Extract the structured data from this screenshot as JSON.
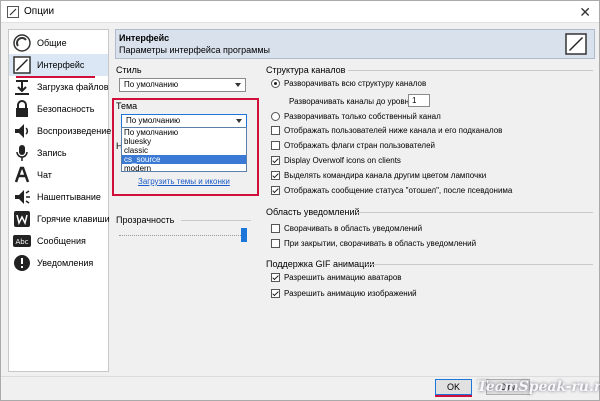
{
  "window": {
    "title": "Опции",
    "close_glyph": "✕"
  },
  "sidebar": {
    "items": [
      {
        "label": "Общие",
        "icon": "general-icon"
      },
      {
        "label": "Интерфейс",
        "icon": "interface-icon",
        "active": true
      },
      {
        "label": "Загрузка файлов",
        "icon": "file-transfer-icon"
      },
      {
        "label": "Безопасность",
        "icon": "security-icon"
      },
      {
        "label": "Воспроизведение",
        "icon": "playback-icon"
      },
      {
        "label": "Запись",
        "icon": "capture-icon"
      },
      {
        "label": "Чат",
        "icon": "chat-icon"
      },
      {
        "label": "Нашептывание",
        "icon": "whisper-icon"
      },
      {
        "label": "Горячие клавиши",
        "icon": "hotkeys-icon"
      },
      {
        "label": "Сообщения",
        "icon": "messages-icon"
      },
      {
        "label": "Уведомления",
        "icon": "notifications-icon"
      }
    ]
  },
  "header": {
    "title": "Интерфейс",
    "subtitle": "Параметры интерфейса программы"
  },
  "left": {
    "style_label": "Стиль",
    "style_value": "По умолчанию",
    "theme_label": "Тема",
    "theme_value": "По умолчанию",
    "theme_options": [
      "По умолчанию",
      "bluesky",
      "classic",
      "cs_source",
      "modern"
    ],
    "theme_highlighted": "cs_source",
    "hidden_letter": "Н",
    "load_link": "Загрузить темы и иконки",
    "transparency_label": "Прозрачность",
    "transparency_value": 1.0
  },
  "channel_tree": {
    "title": "Структура каналов",
    "opt_expand_all": "Разворачивать всю структуру каналов",
    "expand_level_label": "Разворачивать каналы до уровня:",
    "expand_level_value": "1",
    "opt_expand_own": "Разворачивать только собственный канал",
    "show_users_below": "Отображать пользователей ниже канала и его подканалов",
    "show_flags": "Отображать флаги стран пользователей",
    "display_overwolf": "Display Overwolf icons on clients",
    "highlight_commander": "Выделять командира канала другим цветом лампочки",
    "show_away": "Отображать сообщение статуса \"отошел\", после псевдонима"
  },
  "tray": {
    "title": "Область уведомлений",
    "minimize_tray": "Сворачивать в область уведомлений",
    "close_tray": "При закрытии, сворачивать в область уведомлений"
  },
  "gif": {
    "title": "Поддержка GIF анимации",
    "avatars": "Разрешить анимацию аватаров",
    "images": "Разрешить анимацию изображений"
  },
  "buttons": {
    "ok": "OK",
    "cancel": "Отм"
  },
  "watermark": "TeamSpeak-ru.ru",
  "colors": {
    "accent": "#1c75d8",
    "highlight_red": "#d0103a",
    "selection": "#3a79d4"
  }
}
